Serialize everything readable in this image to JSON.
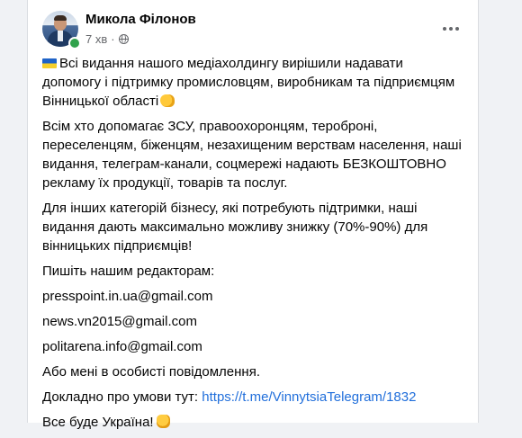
{
  "post": {
    "author": "Микола Філонов",
    "time": "7 хв",
    "separator": "·",
    "privacy_icon": "globe-icon",
    "menu_icon": "more-horizontal-icon"
  },
  "content": {
    "p1": "Всі видання нашого медіахолдингу вирішили надавати допомогу і підтримку промисловцям, виробникам та підприємцям Вінницької області",
    "p2": "Всім хто допомагає ЗСУ, правоохоронцям, тероброні, переселенцям, біженцям, незахищеним верствам населення, наші видання, телеграм-канали, соцмережі надають БЕЗКОШТОВНО рекламу їх продукції, товарів та послуг.",
    "p3": "Для інших категорій бізнесу, які потребують підтримки, наші видання дають максимально можливу знижку (70%-90%) для вінницьких підприємців!",
    "p4": "Пишіть нашим редакторам:",
    "email1": "presspoint.in.ua@gmail.com",
    "email2": "news.vn2015@gmail.com",
    "email3": "politarena.info@gmail.com",
    "p5": "Або мені в особисті повідомлення.",
    "p6_prefix": "Докладно про умови тут: ",
    "p6_link": "https://t.me/VinnytsiaTelegram/1832",
    "p7": "Все буде Україна!"
  },
  "emoji": {
    "flag": "ukraine-flag-emoji",
    "handshake": "handshake-emoji",
    "fist": "raised-fist-emoji"
  },
  "colors": {
    "link": "#216fdb",
    "text": "#050505",
    "secondary": "#65676b",
    "online": "#31a24c"
  }
}
